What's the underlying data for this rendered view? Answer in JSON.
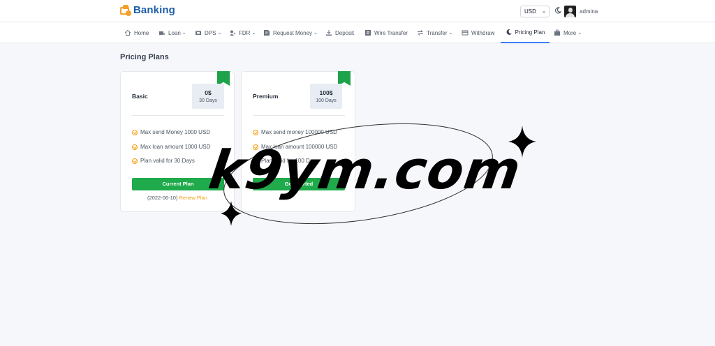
{
  "brand": {
    "name": "Banking"
  },
  "header": {
    "currency": "USD",
    "username": "admina"
  },
  "nav": {
    "home": "Home",
    "loan": "Loan",
    "dps": "DPS",
    "fdr": "FDR",
    "request_money": "Request Money",
    "deposit": "Deposit",
    "wire_transfer": "Wire Transfer",
    "transfer": "Transfer",
    "withdraw": "Withdraw",
    "pricing_plan": "Pricing Plan",
    "more": "More"
  },
  "page": {
    "title": "Pricing Plans"
  },
  "plans": [
    {
      "name": "Basic",
      "price": "0$",
      "period": "30 Days",
      "features": [
        "Max send Money 1000 USD",
        "Max loan amount 1000 USD",
        "Plan valid for 30 Days"
      ],
      "button": "Current Plan",
      "expiry": "(2022-06-10)",
      "renew": "Renew Plan"
    },
    {
      "name": "Premium",
      "price": "100$",
      "period": "100 Days",
      "features": [
        "Max send money 100000 USD",
        "Max loan amount 100000 USD",
        "Plan valid for 100 Days"
      ],
      "button": "Get Started"
    }
  ],
  "watermark": {
    "text": "k9ym.com"
  },
  "colors": {
    "brand": "#1d5fa8",
    "accent": "#f4a12c",
    "success": "#1faa4b",
    "active_tab": "#3b82f6"
  }
}
